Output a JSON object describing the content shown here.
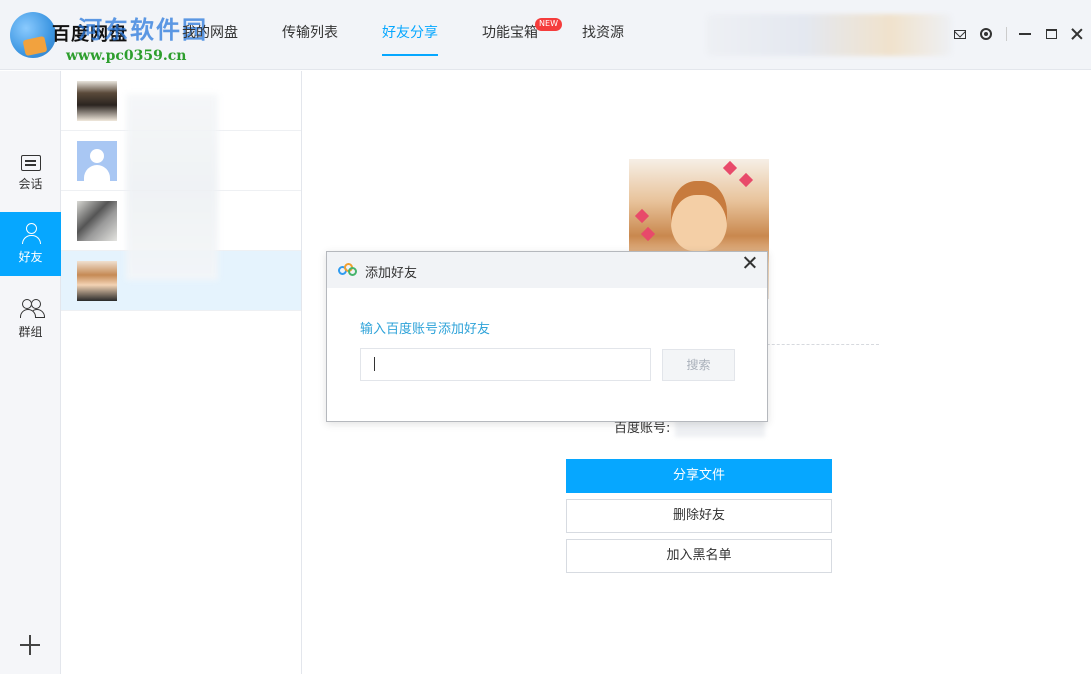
{
  "app": {
    "title": "百度网盘",
    "watermark": "河东软件园",
    "watermark_url": "www.pc0359.cn"
  },
  "nav": {
    "items": [
      {
        "label": "我的网盘"
      },
      {
        "label": "传输列表"
      },
      {
        "label": "好友分享",
        "active": true
      },
      {
        "label": "功能宝箱",
        "badge": "NEW"
      },
      {
        "label": "找资源"
      }
    ]
  },
  "rail": {
    "items": [
      {
        "label": "会话",
        "icon": "chat-icon"
      },
      {
        "label": "好友",
        "icon": "user-icon",
        "active": true
      },
      {
        "label": "群组",
        "icon": "group-icon"
      }
    ]
  },
  "friends": {
    "count_visible": 4,
    "selected_index": 3
  },
  "detail": {
    "account_label": "百度账号:",
    "buttons": {
      "share": "分享文件",
      "delete": "删除好友",
      "blacklist": "加入黑名单"
    }
  },
  "dialog": {
    "title": "添加好友",
    "prompt": "输入百度账号添加好友",
    "input_value": "",
    "search_label": "搜索"
  },
  "colors": {
    "accent": "#06a7ff",
    "badge": "#f53c3c",
    "dialog_prompt": "#2fa3d9",
    "selected_row": "#e5f3fd"
  }
}
